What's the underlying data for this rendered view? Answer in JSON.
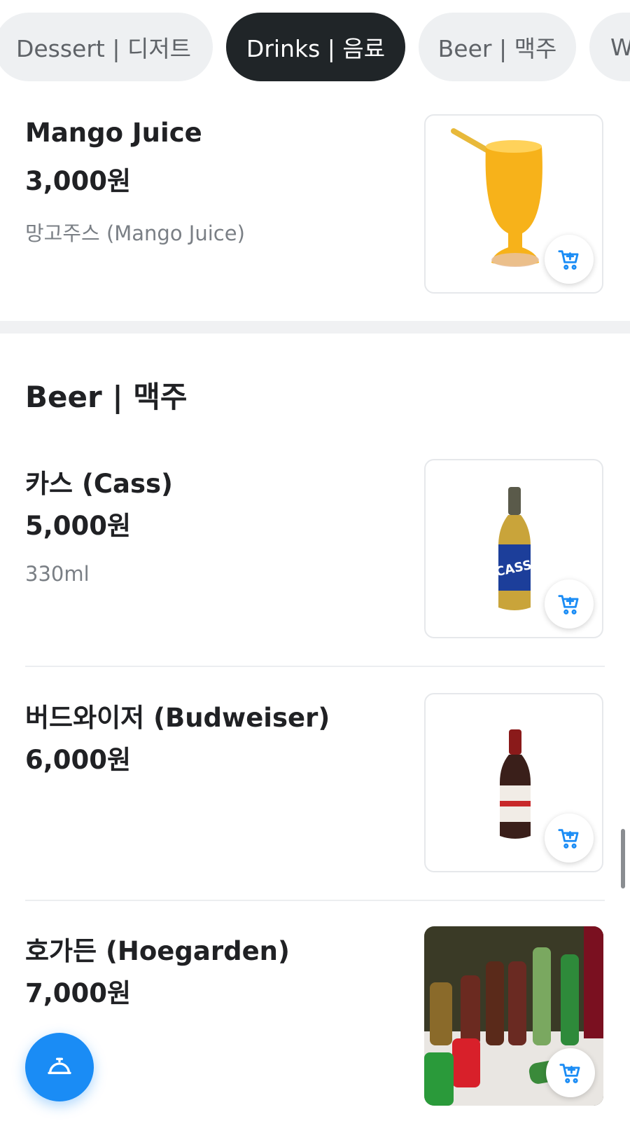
{
  "tabs": [
    {
      "label": "Dessert | 디저트",
      "active": false
    },
    {
      "label": "Drinks | 음료",
      "active": true
    },
    {
      "label": "Beer | 맥주",
      "active": false
    },
    {
      "label": "W",
      "active": false
    }
  ],
  "drinks_item": {
    "name": "Mango Juice",
    "price": "3,000원",
    "description": "망고주스 (Mango Juice)",
    "image_icon": "mango-juice-glass-icon"
  },
  "beer_section": {
    "title": "Beer | 맥주",
    "items": [
      {
        "name": "카스 (Cass)",
        "price": "5,000원",
        "description": "330ml",
        "image_icon": "cass-bottle-icon"
      },
      {
        "name": "버드와이저 (Budweiser)",
        "price": "6,000원",
        "description": "",
        "image_icon": "budweiser-bottle-icon"
      },
      {
        "name": "호가든 (Hoegarden)",
        "price": "7,000원",
        "description": "",
        "image_icon": "assorted-bottles-icon"
      }
    ]
  },
  "icons": {
    "cart": "add-to-cart-icon",
    "fab": "service-bell-icon"
  },
  "colors": {
    "accent": "#1a8cf5",
    "active_tab_bg": "#202528",
    "tab_bg": "#eef0f2"
  }
}
